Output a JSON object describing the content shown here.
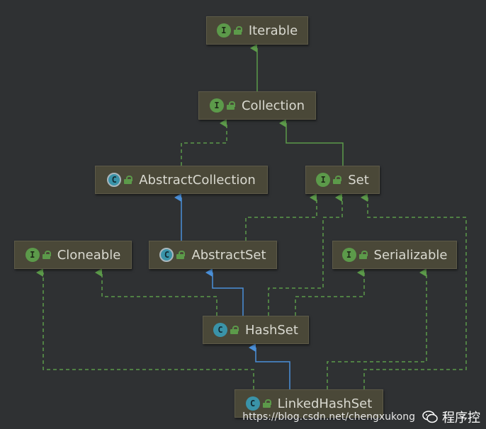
{
  "diagram": {
    "nodes": {
      "iterable": {
        "label": "Iterable",
        "kind": "interface",
        "badge": "I"
      },
      "collection": {
        "label": "Collection",
        "kind": "interface",
        "badge": "I"
      },
      "abstract_collection": {
        "label": "AbstractCollection",
        "kind": "abstract-class",
        "badge": "C"
      },
      "set": {
        "label": "Set",
        "kind": "interface",
        "badge": "I"
      },
      "cloneable": {
        "label": "Cloneable",
        "kind": "interface",
        "badge": "I"
      },
      "abstract_set": {
        "label": "AbstractSet",
        "kind": "abstract-class",
        "badge": "C"
      },
      "serializable": {
        "label": "Serializable",
        "kind": "interface",
        "badge": "I"
      },
      "hash_set": {
        "label": "HashSet",
        "kind": "class",
        "badge": "C"
      },
      "linked_hash_set": {
        "label": "LinkedHashSet",
        "kind": "class",
        "badge": "C"
      }
    },
    "edges": [
      {
        "from": "collection",
        "to": "iterable",
        "type": "extends-interface"
      },
      {
        "from": "abstract_collection",
        "to": "collection",
        "type": "implements"
      },
      {
        "from": "set",
        "to": "collection",
        "type": "extends-interface"
      },
      {
        "from": "abstract_set",
        "to": "abstract_collection",
        "type": "extends"
      },
      {
        "from": "abstract_set",
        "to": "set",
        "type": "implements"
      },
      {
        "from": "hash_set",
        "to": "abstract_set",
        "type": "extends"
      },
      {
        "from": "hash_set",
        "to": "set",
        "type": "implements"
      },
      {
        "from": "hash_set",
        "to": "cloneable",
        "type": "implements"
      },
      {
        "from": "hash_set",
        "to": "serializable",
        "type": "implements"
      },
      {
        "from": "linked_hash_set",
        "to": "hash_set",
        "type": "extends"
      },
      {
        "from": "linked_hash_set",
        "to": "set",
        "type": "implements"
      },
      {
        "from": "linked_hash_set",
        "to": "cloneable",
        "type": "implements"
      },
      {
        "from": "linked_hash_set",
        "to": "serializable",
        "type": "implements"
      }
    ],
    "colors": {
      "background": "#2f3133",
      "node_fill": "#4a4838",
      "interface_badge": "#5c9a4a",
      "class_badge": "#3a93a8",
      "implements_line": "#5c9a4a",
      "extends_line": "#4a90d9",
      "label_text": "#d9d9d0"
    }
  },
  "watermark": {
    "logo_text": "程序控",
    "url": "https://blog.csdn.net/chengxukong",
    "icon": "wechat-chat-icon"
  }
}
